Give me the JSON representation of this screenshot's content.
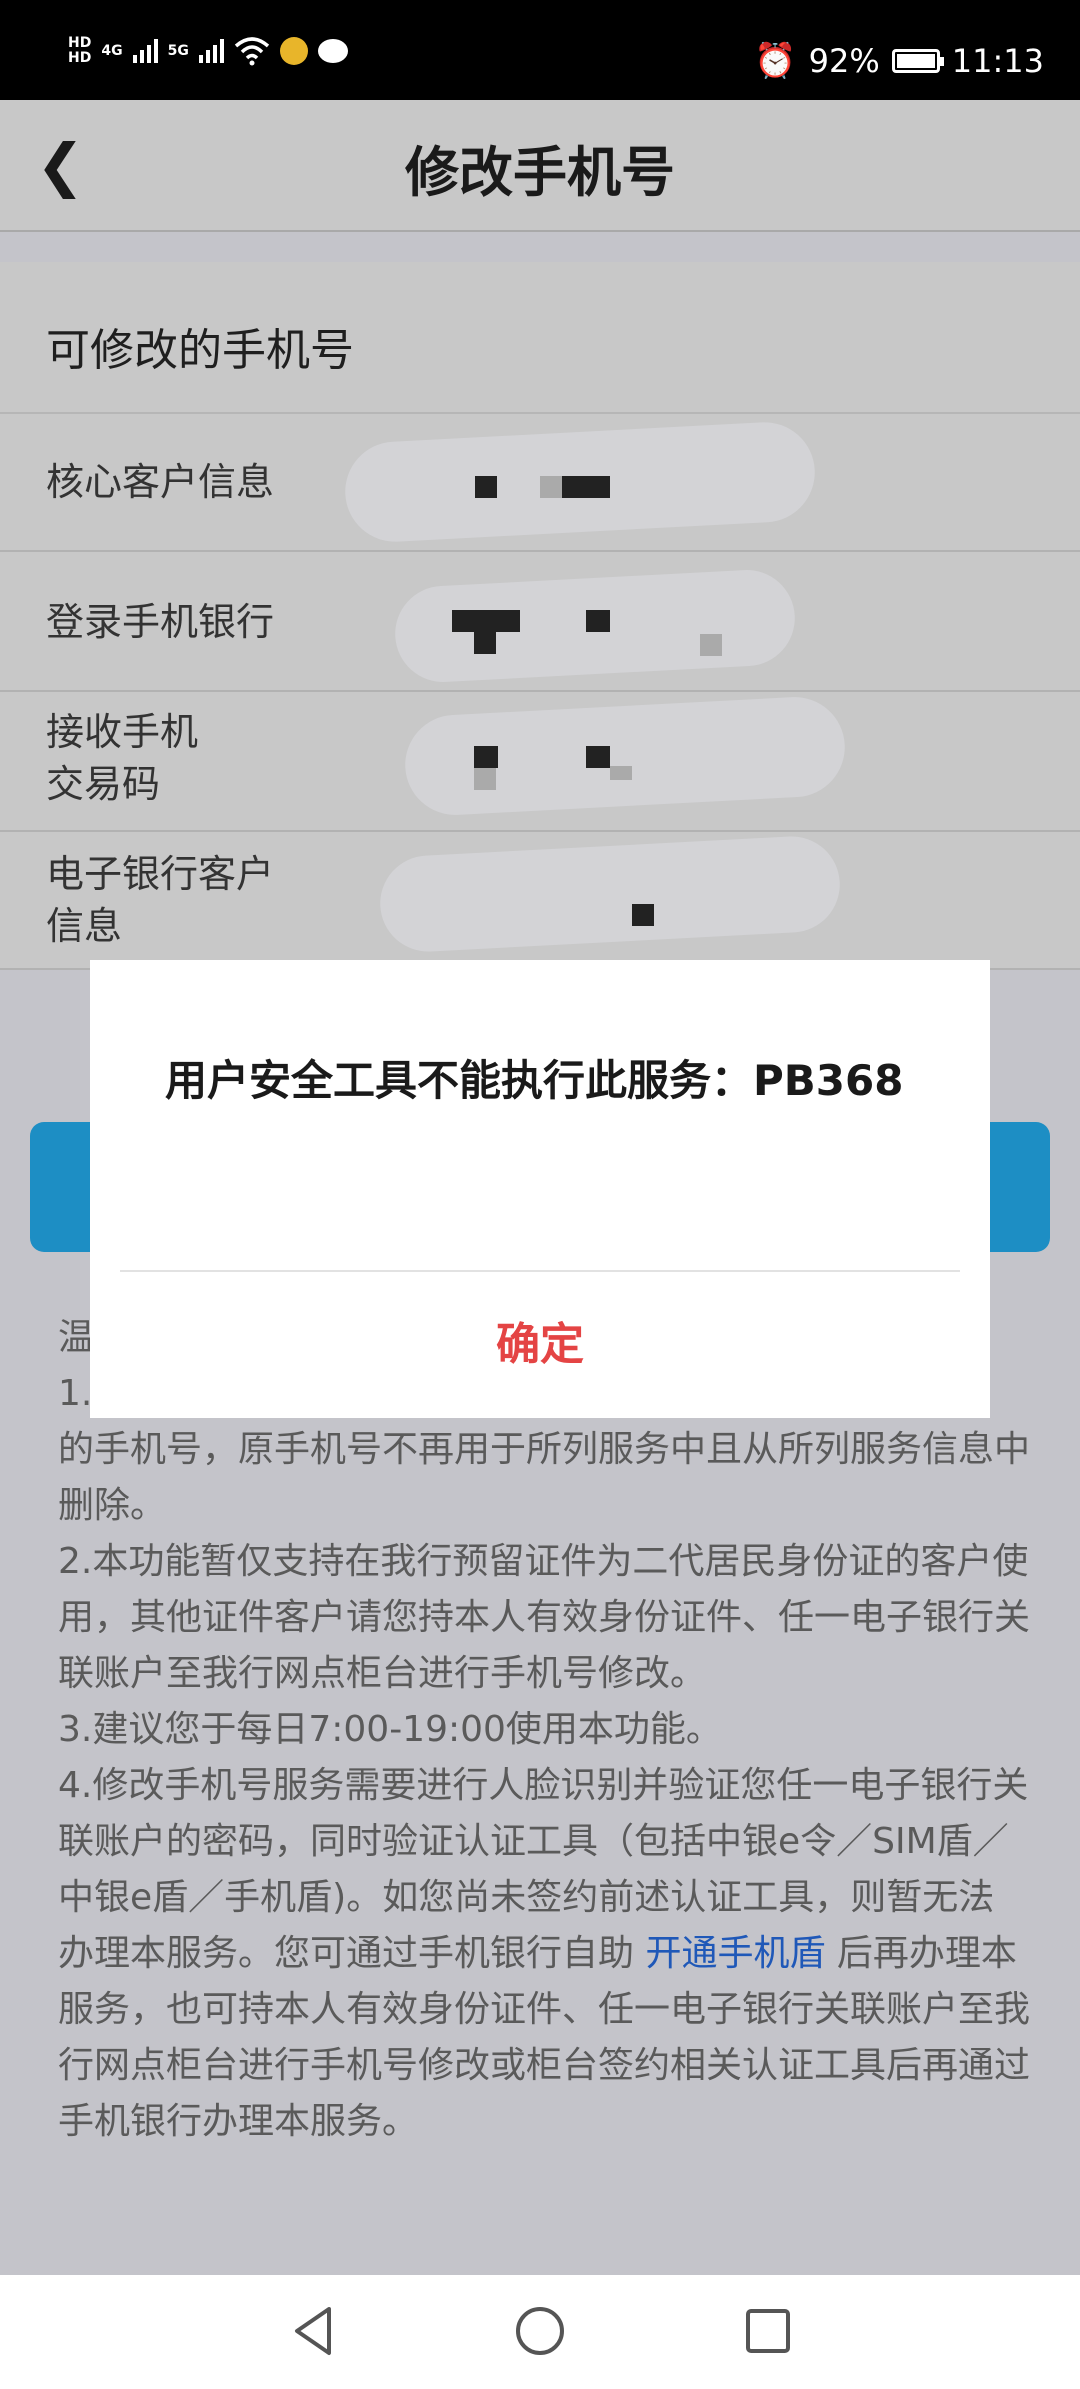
{
  "status_bar": {
    "hd1": "HD",
    "hd2": "HD",
    "net1": "4G",
    "net2": "5G",
    "battery_percent": "92%",
    "time": "11:13",
    "icons": [
      "signal-icon",
      "wifi-icon",
      "shield-icon",
      "message-icon",
      "alarm-icon",
      "battery-icon"
    ]
  },
  "header": {
    "title": "修改手机号",
    "back_icon": "back-arrow-icon"
  },
  "section": {
    "title": "可修改的手机号",
    "rows": [
      {
        "label": "核心客户信息"
      },
      {
        "label": "登录手机银行"
      },
      {
        "label": "接收手机\n交易码"
      },
      {
        "label": "电子银行客户\n信息"
      }
    ]
  },
  "tips": {
    "head": "温",
    "line1_start": "1.",
    "line1_rest": "的手机号，原手机号不再用于所列服务中且从所列服务信息中删除。",
    "line2": "2.本功能暂仅支持在我行预留证件为二代居民身份证的客户使用，其他证件客户请您持本人有效身份证件、任一电子银行关联账户至我行网点柜台进行手机号修改。",
    "line3": "3.建议您于每日7:00-19:00使用本功能。",
    "line4_before": "4.修改手机号服务需要进行人脸识别并验证您任一电子银行关联账户的密码，同时验证认证工具（包括中银e令／SIM盾／中银e盾／手机盾)。如您尚未签约前述认证工具，则暂无法办理本服务。您可通过手机银行自助 ",
    "line4_link": "开通手机盾",
    "line4_after": " 后再办理本服务，也可持本人有效身份证件、任一电子银行关联账户至我行网点柜台进行手机号修改或柜台签约相关认证工具后再通过手机银行办理本服务。"
  },
  "dialog": {
    "message": "用户安全工具不能执行此服务：PB368",
    "confirm_label": "确定"
  },
  "colors": {
    "accent_blue": "#1d8ec4",
    "confirm_red": "#e44444",
    "link_blue": "#1f58b8"
  },
  "system_nav": {
    "icons": [
      "back-triangle-icon",
      "home-circle-icon",
      "recents-square-icon"
    ]
  }
}
